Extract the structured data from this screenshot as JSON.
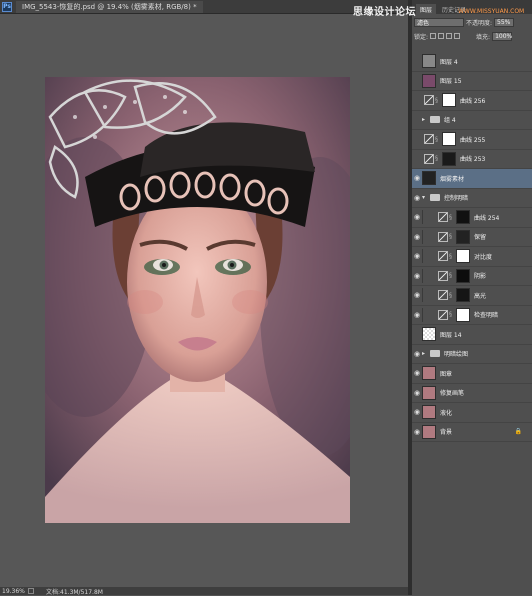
{
  "window": {
    "ps_logo": "Ps",
    "doc_tab": "IMG_5543-恢复的.psd @ 19.4% (烟雾素材, RGB/8) *"
  },
  "watermark": {
    "text": "思缘设计论坛",
    "sub": "WWW.MISSYUAN.COM"
  },
  "panel_tabs": [
    "图层",
    "历史记录"
  ],
  "blend": {
    "mode": "滤色",
    "opacity_label": "不透明度:",
    "opacity_value": "55%",
    "lock_label": "锁定:",
    "fill_label": "填充:",
    "fill_value": "100%"
  },
  "layers": [
    {
      "name": "图层 4",
      "type": "pixel",
      "visible": false,
      "thumb": "#888888"
    },
    {
      "name": "图层 15",
      "type": "pixel",
      "visible": false,
      "thumb": "#7a4a6a"
    },
    {
      "name": "曲线 256",
      "type": "adjust",
      "visible": false,
      "mask": "#ffffff"
    },
    {
      "name": "组 4",
      "type": "group",
      "visible": false
    },
    {
      "name": "曲线 255",
      "type": "adjust",
      "visible": false,
      "mask": "#ffffff"
    },
    {
      "name": "曲线 253",
      "type": "adjust",
      "visible": false,
      "mask": "#1a1a1a"
    },
    {
      "name": "烟雾素材",
      "type": "pixel",
      "visible": true,
      "selected": true,
      "thumb": "#222222"
    },
    {
      "name": "控制明暗",
      "type": "group-open",
      "visible": true
    },
    {
      "name": "曲线 254",
      "type": "adjust",
      "visible": true,
      "mask": "#111111"
    },
    {
      "name": "保留",
      "type": "adjust",
      "visible": true,
      "mask": "#222222"
    },
    {
      "name": "对比度",
      "type": "adjust",
      "visible": true,
      "mask": "#ffffff"
    },
    {
      "name": "阴影",
      "type": "adjust",
      "visible": true,
      "mask": "#0d0d0d"
    },
    {
      "name": "高光",
      "type": "adjust",
      "visible": true,
      "mask": "#151515"
    },
    {
      "name": "检查明暗",
      "type": "adjust",
      "visible": true,
      "mask": "#ffffff"
    },
    {
      "name": "图层 14",
      "type": "pixel",
      "visible": false,
      "thumb": "checker"
    },
    {
      "name": "明暗绘图",
      "type": "group",
      "visible": true
    },
    {
      "name": "图章",
      "type": "pixel",
      "visible": true,
      "thumb": "#b07a80"
    },
    {
      "name": "修复画笔",
      "type": "pixel",
      "visible": true,
      "thumb": "#b07a80"
    },
    {
      "name": "液化",
      "type": "pixel",
      "visible": true,
      "thumb": "#b07a80"
    },
    {
      "name": "背景",
      "type": "pixel",
      "visible": true,
      "thumb": "#b07a80",
      "locked": true
    }
  ],
  "status": {
    "zoom": "19.36%",
    "doc_size": "文档:41.3M/517.8M"
  },
  "icons": {
    "eye": "eye-icon",
    "lock": "lock-icon",
    "chain": "link-icon",
    "folder": "folder-icon"
  }
}
